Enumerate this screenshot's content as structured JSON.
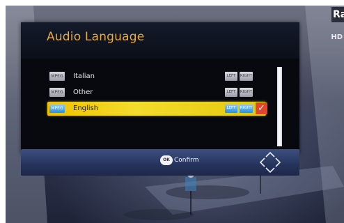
{
  "overlay": {
    "channel_logo_text": "Ra",
    "hd_text": "HD"
  },
  "dialog": {
    "title": "Audio Language",
    "items": [
      {
        "codec": "MPEG",
        "label": "Italian",
        "left": "LEFT",
        "right": "RIGHT",
        "selected": false
      },
      {
        "codec": "MPEG",
        "label": "Other",
        "left": "LEFT",
        "right": "RIGHT",
        "selected": false
      },
      {
        "codec": "MPEG",
        "label": "English",
        "left": "LEFT",
        "right": "RIGHT",
        "selected": true
      }
    ],
    "check_glyph": "✓"
  },
  "footer": {
    "ok_key": "OK",
    "confirm_label": "Confirm"
  },
  "icons": {
    "check": "check-icon",
    "ok": "ok-key-icon",
    "nav": "dpad-icon"
  },
  "colors": {
    "title": "#e9a93b",
    "selected_row": "#f0c000",
    "check": "#e2452c",
    "footer": "#2e3d6a"
  }
}
